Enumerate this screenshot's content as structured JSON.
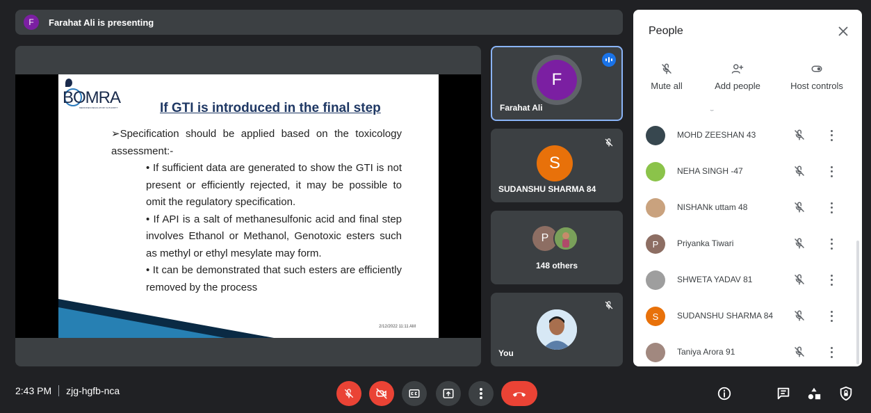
{
  "banner": {
    "avatar_letter": "F",
    "text": "Farahat Ali is presenting"
  },
  "slide": {
    "logo_text": "BOMRA",
    "logo_subtitle": "MEDICINES REGULATORY AUTHORITY",
    "title": "If GTI is introduced in the final step",
    "lead": "➢Specification should be applied based on the toxicology assessment:-",
    "points": [
      "• If sufficient data are generated to show the GTI is not present or efficiently rejected, it may be possible to omit the regulatory specification.",
      "• If API is a salt of methanesulfonic acid and final step involves Ethanol or Methanol, Genotoxic esters such as methyl or ethyl mesylate may form.",
      "• It can be demonstrated that such esters are efficiently removed by the process"
    ],
    "date": "2/12/2022 11:11 AM"
  },
  "tiles": {
    "farahat": {
      "letter": "F",
      "name": "Farahat Ali",
      "color": "#7b1fa2"
    },
    "sudanshu": {
      "letter": "S",
      "name": "SUDANSHU SHARMA 84",
      "color": "#e8710a"
    },
    "others": {
      "letter": "P",
      "label": "148 others",
      "color": "#8d6e63"
    },
    "you": {
      "name": "You"
    }
  },
  "people": {
    "title": "People",
    "actions": {
      "mute_all": "Mute all",
      "add_people": "Add people",
      "host_controls": "Host controls"
    },
    "partial_row": "g",
    "participants": [
      {
        "name": "MOHD ZEESHAN 43",
        "avatar": "photo",
        "color": "#37474f"
      },
      {
        "name": "NEHA SINGH -47",
        "avatar": "photo",
        "color": "#8bc34a"
      },
      {
        "name": "NISHANk uttam 48",
        "avatar": "photo",
        "color": "#c9a27e"
      },
      {
        "name": "Priyanka Tiwari",
        "avatar": "P",
        "color": "#8d6e63"
      },
      {
        "name": "SHWETA YADAV 81",
        "avatar": "photo",
        "color": "#9e9e9e"
      },
      {
        "name": "SUDANSHU SHARMA 84",
        "avatar": "S",
        "color": "#e8710a"
      },
      {
        "name": "Taniya Arora 91",
        "avatar": "photo",
        "color": "#a1887f"
      }
    ]
  },
  "bottom": {
    "time": "2:43 PM",
    "meeting_code": "zjg-hgfb-nca"
  },
  "colors": {
    "end_call": "#ea4335",
    "accent": "#8ab4f8",
    "bg": "#202124"
  }
}
